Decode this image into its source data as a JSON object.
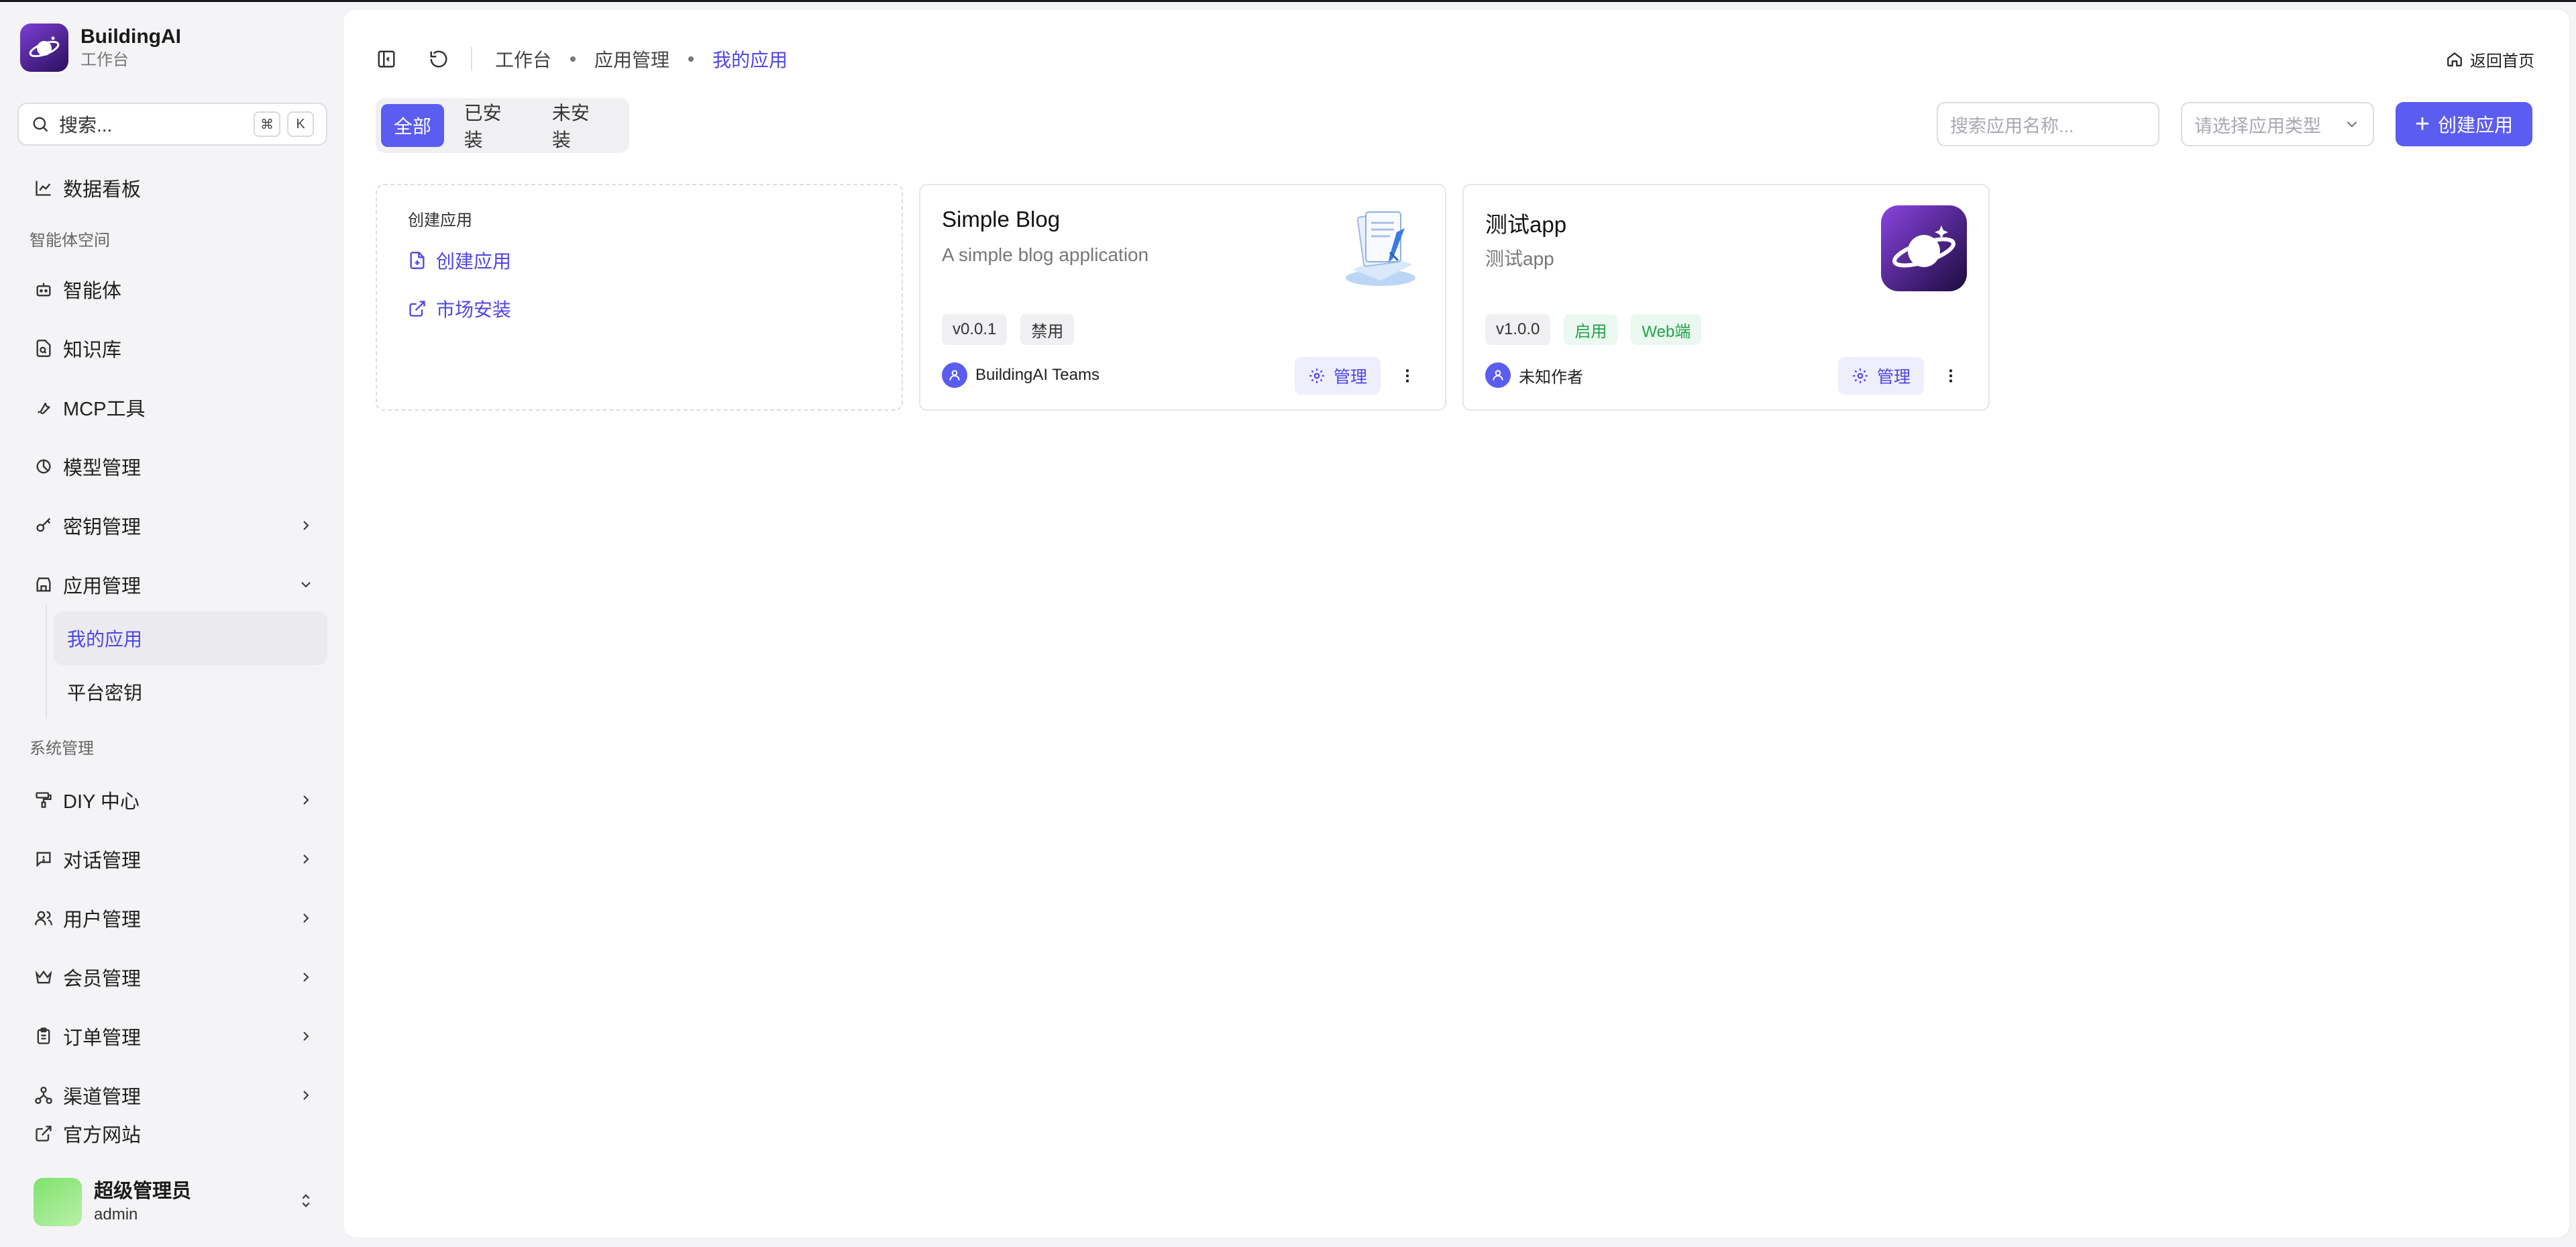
{
  "brand": {
    "name": "BuildingAI",
    "subtitle": "工作台"
  },
  "sidebar": {
    "search": {
      "label": "搜索...",
      "kbd1": "⌘",
      "kbd2": "K"
    },
    "dashboard": "数据看板",
    "section_agent_space": "智能体空间",
    "agent": "智能体",
    "knowledge": "知识库",
    "mcp": "MCP工具",
    "model": "模型管理",
    "secret": "密钥管理",
    "apps": "应用管理",
    "apps_sub": {
      "my_apps": "我的应用",
      "platform_key": "平台密钥"
    },
    "section_system": "系统管理",
    "diy": "DIY 中心",
    "conversation": "对话管理",
    "users": "用户管理",
    "members": "会员管理",
    "orders": "订单管理",
    "channels": "渠道管理",
    "website": "官方网站"
  },
  "user": {
    "name": "超级管理员",
    "role": "admin"
  },
  "header": {
    "breadcrumb": [
      "工作台",
      "应用管理",
      "我的应用"
    ],
    "home_link": "返回首页"
  },
  "tabs": [
    "全部",
    "已安装",
    "未安装"
  ],
  "filters": {
    "search_placeholder": "搜索应用名称...",
    "type_placeholder": "请选择应用类型",
    "create_label": "创建应用"
  },
  "create_card": {
    "title": "创建应用",
    "create_link": "创建应用",
    "market_link": "市场安装"
  },
  "apps": [
    {
      "name": "Simple Blog",
      "desc": "A simple blog application",
      "version": "v0.0.1",
      "status": "禁用",
      "author": "BuildingAI Teams",
      "manage": "管理",
      "icon": "blog-book-icon"
    },
    {
      "name": "测试app",
      "desc": "测试app",
      "version": "v1.0.0",
      "status": "启用",
      "platform": "Web端",
      "author": "未知作者",
      "manage": "管理",
      "icon": "planet-logo-icon"
    }
  ],
  "colors": {
    "accent": "#5b5cf0",
    "accent_text": "#4f46e5",
    "success": "#22a24b"
  }
}
